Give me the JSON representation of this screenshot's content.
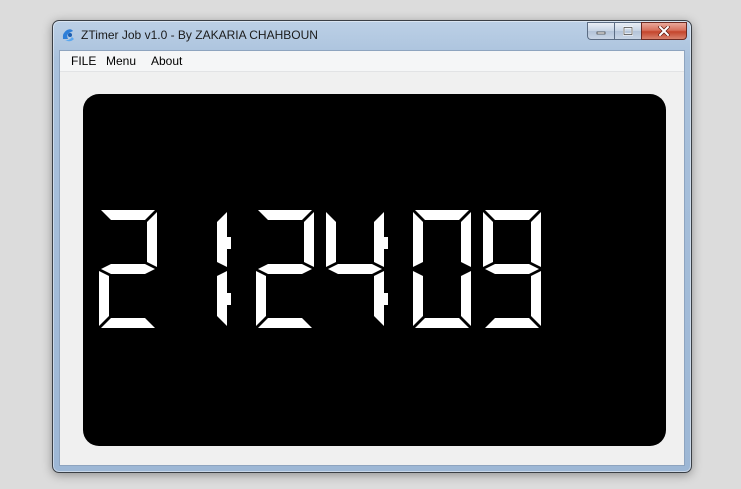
{
  "window": {
    "title": "ZTimer Job v1.0 - By ZAKARIA CHAHBOUN",
    "icon": "ztimer-app-icon",
    "controls": [
      "minimize-icon",
      "maximize-icon",
      "close-icon"
    ]
  },
  "menubar": {
    "items": [
      {
        "label": "FILE"
      },
      {
        "label": "Menu"
      },
      {
        "label": "About"
      }
    ]
  },
  "clock": {
    "time": "21:24:09",
    "digit_color": "#ffffff",
    "panel_color": "#000000"
  }
}
